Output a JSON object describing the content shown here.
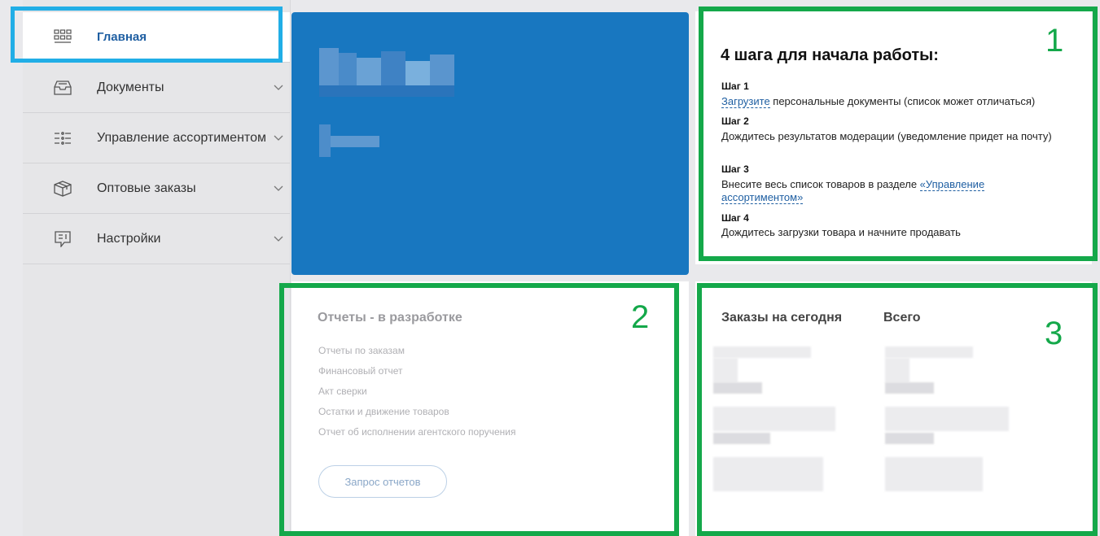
{
  "sidebar": {
    "items": [
      {
        "label": "Главная",
        "icon": "grid-icon",
        "active": true
      },
      {
        "label": "Документы",
        "icon": "inbox-icon"
      },
      {
        "label": "Управление ассортиментом",
        "icon": "list-icon"
      },
      {
        "label": "Оптовые заказы",
        "icon": "box-icon"
      },
      {
        "label": "Настройки",
        "icon": "chat-settings-icon"
      }
    ]
  },
  "steps": {
    "title": "4 шага для начала работы:",
    "s1_h": "Шаг 1",
    "s1_link": "Загрузите",
    "s1_text": " персональные документы (список может отличаться)",
    "s2_h": "Шаг 2",
    "s2_text": "Дождитесь результатов модерации (уведомление придет на почту)",
    "s3_h": "Шаг 3",
    "s3_text": "Внесите весь список товаров в разделе ",
    "s3_link": "«Управление ассортиментом»",
    "s4_h": "Шаг 4",
    "s4_text": "Дождитесь загрузки товара и начните продавать"
  },
  "reports": {
    "title": "Отчеты - в разработке",
    "items": [
      "Отчеты по заказам",
      "Финансовый отчет",
      "Акт сверки",
      "Остатки и движение товаров",
      "Отчет об исполнении агентского поручения"
    ],
    "button": "Запрос отчетов"
  },
  "orders": {
    "today": "Заказы на сегодня",
    "total": "Всего"
  },
  "annotations": {
    "a1": "1",
    "a2": "2",
    "a3": "3"
  },
  "colors": {
    "accent": "#1f5fa2",
    "hero": "#1877c0",
    "highlight_blue": "#21aee6",
    "annotation_green": "#14a84a"
  }
}
